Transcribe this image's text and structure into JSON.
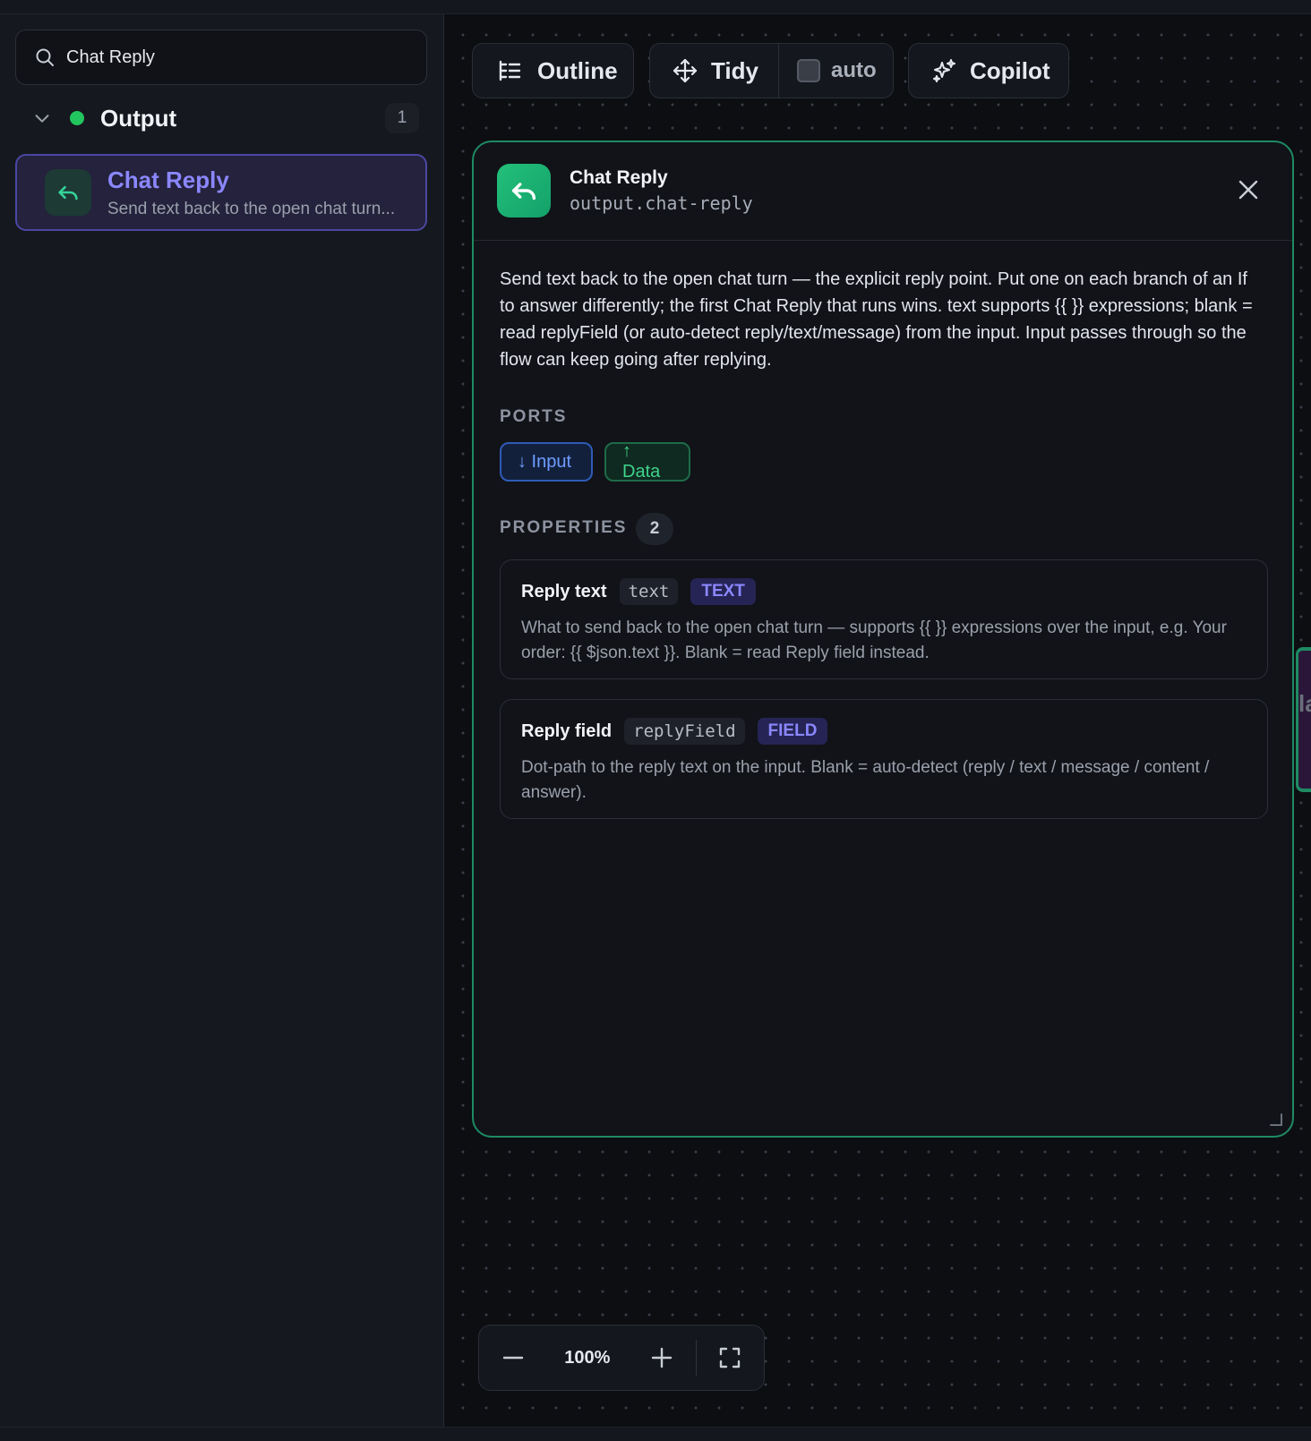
{
  "search": {
    "value": "Chat Reply",
    "placeholder": ""
  },
  "sidebar": {
    "group": {
      "label": "Output",
      "count": "1",
      "status_color": "#22c55e"
    },
    "items": [
      {
        "title": "Chat Reply",
        "description": "Send text back to the open chat turn..."
      }
    ]
  },
  "toolbar": {
    "outline_label": "Outline",
    "tidy_label": "Tidy",
    "auto_label": "auto",
    "auto_checked": false,
    "copilot_label": "Copilot"
  },
  "panel": {
    "title": "Chat Reply",
    "type_id": "output.chat-reply",
    "description": "Send text back to the open chat turn — the explicit reply point. Put one on each branch of an If to answer differently; the first Chat Reply that runs wins. text supports {{ }} expressions; blank = read replyField (or auto-detect reply/text/message) from the input. Input passes through so the flow can keep going after replying.",
    "ports_label": "PORTS",
    "ports": [
      {
        "label": "↓ Input"
      },
      {
        "label": "↑ Data"
      }
    ],
    "properties_label": "PROPERTIES",
    "properties_count": "2",
    "properties": [
      {
        "name": "Reply text",
        "key": "text",
        "kind": "TEXT",
        "description": "What to send back to the open chat turn — supports {{ }} expressions over the input, e.g. Your order: {{ $json.text }}. Blank = read Reply field instead."
      },
      {
        "name": "Reply field",
        "key": "replyField",
        "kind": "FIELD",
        "description": "Dot-path to the reply text on the input. Blank = auto-detect (reply / text / message / content / answer)."
      }
    ]
  },
  "peek": {
    "text": "la"
  },
  "zoom": {
    "level": "100%"
  },
  "colors": {
    "accent": "#8b87ff",
    "panel_border": "#1f8a62",
    "node_icon": "#23c07a"
  }
}
